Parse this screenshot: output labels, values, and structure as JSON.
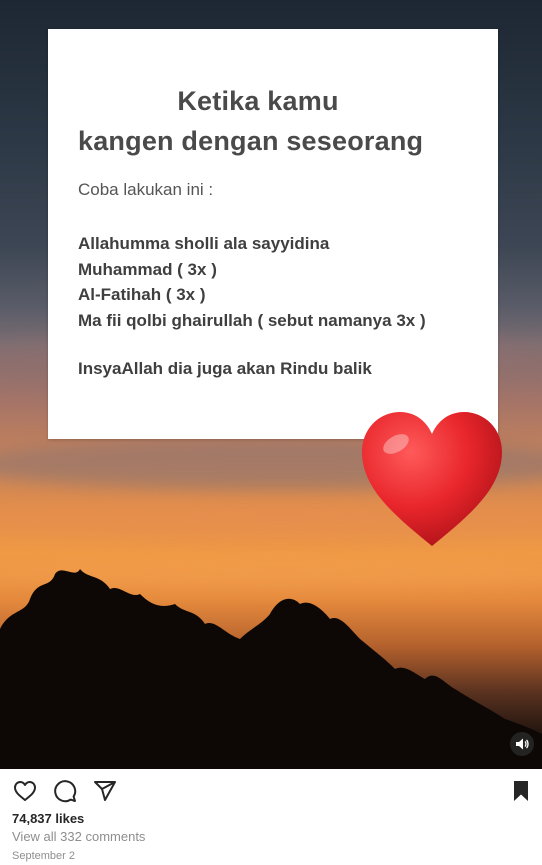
{
  "card": {
    "title_line1": "Ketika kamu",
    "title_line2": "kangen dengan seseorang",
    "intro": "Coba lakukan ini :",
    "steps": [
      "Allahumma sholli ala sayyidina",
      "Muhammad  ( 3x )",
      "Al-Fatihah  ( 3x )",
      "Ma fii qolbi ghairullah ( sebut namanya 3x )"
    ],
    "closing": "InsyaAllah dia juga akan Rindu balik"
  },
  "icons": {
    "heart_sticker": "heart-icon",
    "sound": "speaker-icon",
    "like": "heart-outline-icon",
    "comment": "comment-icon",
    "share": "paper-plane-icon",
    "save": "bookmark-icon"
  },
  "colors": {
    "heart": "#e8262b",
    "sky_top": "#1d2733",
    "sunset": "#f09a45"
  },
  "post": {
    "likes": "74,837 likes",
    "comments_link": "View all 332 comments",
    "date": "September 2"
  }
}
